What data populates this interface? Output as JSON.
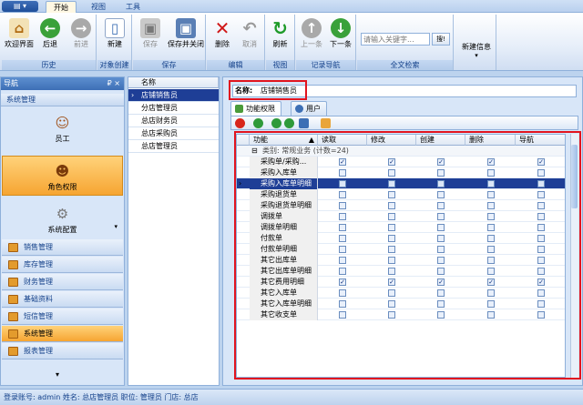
{
  "ribbon": {
    "app_button": "▤ ▾",
    "tabs": [
      "开始",
      "视图",
      "工具"
    ],
    "groups": [
      {
        "label": "历史",
        "buttons": [
          {
            "label": "欢迎界面",
            "icon": "home-icon"
          },
          {
            "label": "后退",
            "icon": "back-arrow-icon"
          },
          {
            "label": "前进",
            "icon": "forward-arrow-icon",
            "disabled": true
          }
        ]
      },
      {
        "label": "对象创建",
        "buttons": [
          {
            "label": "新建",
            "icon": "new-document-icon"
          }
        ]
      },
      {
        "label": "保存",
        "buttons": [
          {
            "label": "保存",
            "icon": "save-icon",
            "disabled": true
          },
          {
            "label": "保存并关闭",
            "icon": "save-close-icon"
          }
        ]
      },
      {
        "label": "编辑",
        "buttons": [
          {
            "label": "删除",
            "icon": "delete-x-icon"
          },
          {
            "label": "取消",
            "icon": "undo-icon",
            "disabled": true
          }
        ]
      },
      {
        "label": "视图",
        "buttons": [
          {
            "label": "刷新",
            "icon": "refresh-icon"
          }
        ]
      },
      {
        "label": "记录导航",
        "buttons": [
          {
            "label": "上一条",
            "icon": "up-arrow-icon",
            "disabled": true
          },
          {
            "label": "下一条",
            "icon": "down-arrow-icon"
          }
        ]
      },
      {
        "label": "全文检索"
      },
      {
        "label": "",
        "buttons": [
          {
            "label": "新建信息",
            "icon": "new-info-icon"
          }
        ]
      }
    ],
    "search_placeholder": "请输入关键字...",
    "search_button": "搜!"
  },
  "nav": {
    "title": "导航",
    "header_icons": "₽ ×",
    "section": "系统管理",
    "big_items": [
      {
        "label": "员工",
        "icon": "employee-icon"
      },
      {
        "label": "角色权限",
        "icon": "role-icon",
        "selected": true
      },
      {
        "label": "系统配置",
        "icon": "gear-icon"
      }
    ],
    "rows": [
      "销售管理",
      "库存管理",
      "财务管理",
      "基础资料",
      "短信管理",
      "系统管理",
      "报表管理"
    ],
    "selected_row": "系统管理"
  },
  "role_list": {
    "header": "名称",
    "items": [
      "店铺销售员",
      "分店管理员",
      "总店财务员",
      "总店采购员",
      "总店管理员"
    ],
    "selected": "店铺销售员"
  },
  "detail": {
    "name_label": "名称:",
    "name_value": "店铺销售员",
    "tabs": [
      "功能权限",
      "用户"
    ],
    "columns": [
      "功能",
      "读取",
      "修改",
      "创建",
      "删除",
      "导航"
    ],
    "group_row": "类别: 常规业务 (计数=24)",
    "rows": [
      {
        "name": "采购单/采购...",
        "checks": [
          true,
          true,
          true,
          true,
          true
        ]
      },
      {
        "name": "采购入库单",
        "checks": [
          false,
          false,
          false,
          false,
          false
        ]
      },
      {
        "name": "采购入库单明细",
        "checks": [
          false,
          false,
          false,
          false,
          false
        ],
        "selected": true
      },
      {
        "name": "采购退货单",
        "checks": [
          false,
          false,
          false,
          false,
          false
        ]
      },
      {
        "name": "采购退货单明细",
        "checks": [
          false,
          false,
          false,
          false,
          false
        ]
      },
      {
        "name": "调拨单",
        "checks": [
          false,
          false,
          false,
          false,
          false
        ]
      },
      {
        "name": "调拨单明细",
        "checks": [
          false,
          false,
          false,
          false,
          false
        ]
      },
      {
        "name": "付款单",
        "checks": [
          false,
          false,
          false,
          false,
          false
        ]
      },
      {
        "name": "付款单明细",
        "checks": [
          false,
          false,
          false,
          false,
          false
        ]
      },
      {
        "name": "其它出库单",
        "checks": [
          false,
          false,
          false,
          false,
          false
        ]
      },
      {
        "name": "其它出库单明细",
        "checks": [
          false,
          false,
          false,
          false,
          false
        ]
      },
      {
        "name": "其它费用明细",
        "checks": [
          true,
          true,
          true,
          true,
          true
        ]
      },
      {
        "name": "其它入库单",
        "checks": [
          false,
          false,
          false,
          false,
          false
        ]
      },
      {
        "name": "其它入库单明细",
        "checks": [
          false,
          false,
          false,
          false,
          false
        ]
      },
      {
        "name": "其它收支单",
        "checks": [
          false,
          false,
          false,
          false,
          false
        ]
      }
    ]
  },
  "status": "登录账号: admin  姓名: 总店管理员  职位: 管理员  门店: 总店",
  "colors": {
    "accent": "#15428b",
    "highlight": "#e1141f",
    "selected_row": "#1e3e96",
    "nav_selected": "#f6a532"
  }
}
